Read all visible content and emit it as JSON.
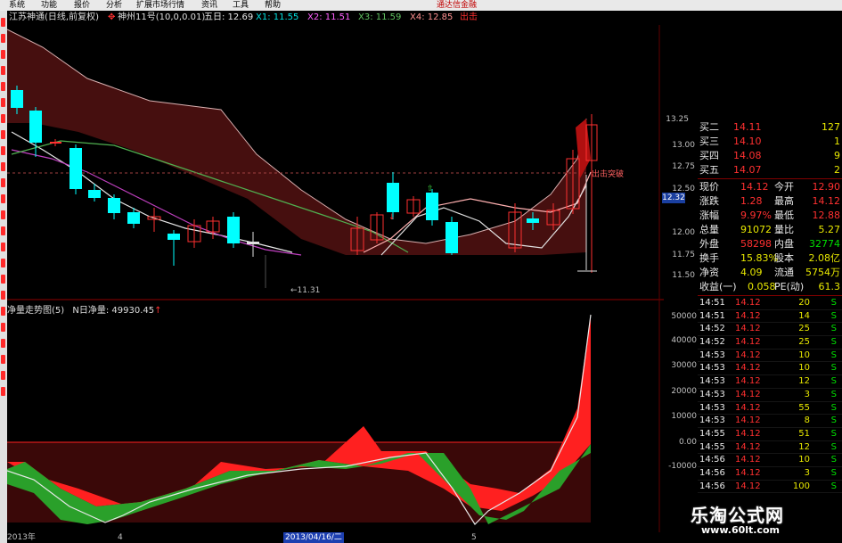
{
  "menu": {
    "items": [
      "系统",
      "功能",
      "报价",
      "分析",
      "扩展市场行情",
      "资讯",
      "工具",
      "帮助"
    ],
    "brand": "通达信金融"
  },
  "title_bar": {
    "stock": "江苏神通(日线,前复权)",
    "indicator": "神州11号(10,0,0.01)",
    "ma5_label": "五日: 12.69",
    "x1": "X1: 11.55",
    "x2": "X2: 11.51",
    "x3": "X3: 11.59",
    "x4": "X4: 12.85",
    "signal": "出击"
  },
  "main_chart": {
    "annotation_breakout": "出击突破",
    "low_label": "←11.31",
    "y_ticks": [
      "13.00",
      "12.75",
      "12.50",
      "12.00",
      "11.75",
      "11.50"
    ],
    "y_tick_top": "13.25",
    "current_price_box": "12.32",
    "upper_band_color": "#4a1010",
    "bull_candle_color": "#ff3030",
    "bear_candle_color": "#00ffff"
  },
  "lower_panel": {
    "title": "净量走势图(5)",
    "n_label": "N日净量:",
    "n_value": "49930.45",
    "y_ticks": [
      "50000",
      "40000",
      "30000",
      "20000",
      "10000",
      "0.00",
      "-10000"
    ],
    "pos_color": "#ff2020",
    "neg_color": "#2aa02a"
  },
  "bottom_axis": {
    "labels": [
      "2013年",
      "4",
      "2013/04/16/二",
      "5"
    ]
  },
  "quote_panel": {
    "bid_levels": [
      {
        "label": "买二",
        "price": "14.11",
        "volume": "127"
      },
      {
        "label": "买三",
        "price": "14.10",
        "volume": "1"
      },
      {
        "label": "买四",
        "price": "14.08",
        "volume": "9"
      },
      {
        "label": "买五",
        "price": "14.07",
        "volume": "2"
      }
    ],
    "stats": [
      {
        "l1": "现价",
        "v1": "14.12",
        "l2": "今开",
        "v2": "12.90"
      },
      {
        "l1": "涨跌",
        "v1": "1.28",
        "l2": "最高",
        "v2": "14.12"
      },
      {
        "l1": "涨幅",
        "v1": "9.97%",
        "l2": "最低",
        "v2": "12.88"
      },
      {
        "l1": "总量",
        "v1": "91072",
        "l2": "量比",
        "v2": "5.27"
      },
      {
        "l1": "外盘",
        "v1": "58298",
        "l2": "内盘",
        "v2": "32774"
      },
      {
        "l1": "换手",
        "v1": "15.83%",
        "l2": "股本",
        "v2": "2.08亿"
      },
      {
        "l1": "净资",
        "v1": "4.09",
        "l2": "流通",
        "v2": "5754万"
      },
      {
        "l1": "收益(一)",
        "v1": "0.058",
        "l2": "PE(动)",
        "v2": "61.3"
      }
    ],
    "ticks": [
      {
        "time": "14:51",
        "price": "14.12",
        "vol": "20",
        "side": "S"
      },
      {
        "time": "14:51",
        "price": "14.12",
        "vol": "14",
        "side": "S"
      },
      {
        "time": "14:52",
        "price": "14.12",
        "vol": "25",
        "side": "S"
      },
      {
        "time": "14:52",
        "price": "14.12",
        "vol": "25",
        "side": "S"
      },
      {
        "time": "14:53",
        "price": "14.12",
        "vol": "10",
        "side": "S"
      },
      {
        "time": "14:53",
        "price": "14.12",
        "vol": "10",
        "side": "S"
      },
      {
        "time": "14:53",
        "price": "14.12",
        "vol": "12",
        "side": "S"
      },
      {
        "time": "14:53",
        "price": "14.12",
        "vol": "3",
        "side": "S"
      },
      {
        "time": "14:53",
        "price": "14.12",
        "vol": "55",
        "side": "S"
      },
      {
        "time": "14:53",
        "price": "14.12",
        "vol": "8",
        "side": "S"
      },
      {
        "time": "14:55",
        "price": "14.12",
        "vol": "51",
        "side": "S"
      },
      {
        "time": "14:55",
        "price": "14.12",
        "vol": "12",
        "side": "S"
      },
      {
        "time": "14:56",
        "price": "14.12",
        "vol": "10",
        "side": "S"
      },
      {
        "time": "14:56",
        "price": "14.12",
        "vol": "3",
        "side": "S"
      },
      {
        "time": "14:56",
        "price": "14.12",
        "vol": "100",
        "side": "S"
      }
    ]
  },
  "watermark": {
    "cn": "乐淘公式网",
    "url": "www.60lt.com"
  }
}
